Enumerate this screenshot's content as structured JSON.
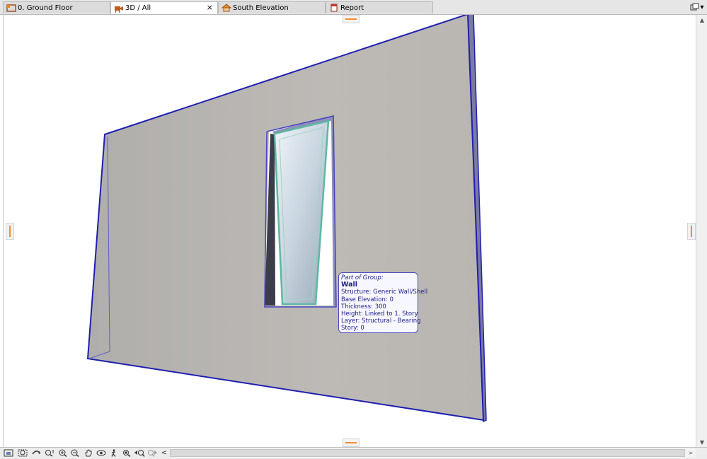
{
  "tabs": [
    {
      "label": "0. Ground Floor",
      "icon": "floor-plan-icon",
      "active": false
    },
    {
      "label": "3D / All",
      "icon": "3d-camera-icon",
      "active": true,
      "close": "×"
    },
    {
      "label": "South Elevation",
      "icon": "elevation-icon",
      "active": false
    },
    {
      "label": "Report",
      "icon": "report-icon",
      "active": false
    }
  ],
  "tabbar_menu": {
    "icon": "tab-list-icon",
    "caret": "▾"
  },
  "tooltip": {
    "caption": "Part of Group:",
    "title": "Wall",
    "lines": [
      "Structure: Generic Wall/Shell",
      "Base Elevation: 0",
      "Thickness: 300",
      "Height: Linked to 1. Story",
      "Layer: Structural - Bearing",
      "Story: 0"
    ]
  },
  "scrollbar": {
    "up": "▲",
    "down": "▼",
    "left_arrow": "<",
    "right_arrow": ">"
  },
  "nav_tools": [
    "fit-in-window-icon",
    "zoom-area-icon",
    "orbit-icon",
    "zoom-realtime-icon",
    "zoom-in-icon",
    "zoom-out-icon",
    "pan-hand-icon",
    "explore-eye-icon",
    "walk-person-icon",
    "previous-zoom-icon",
    "back-zoom-icon",
    "next-zoom-icon"
  ],
  "colors": {
    "wall_face": "#b8b5b0",
    "wall_edge": "#1f1fb0",
    "glass": "#cfdbe4",
    "glass_frame": "#5fb7a2",
    "handle": "#f08c2a",
    "tooltip_border": "#4a4ac2"
  }
}
